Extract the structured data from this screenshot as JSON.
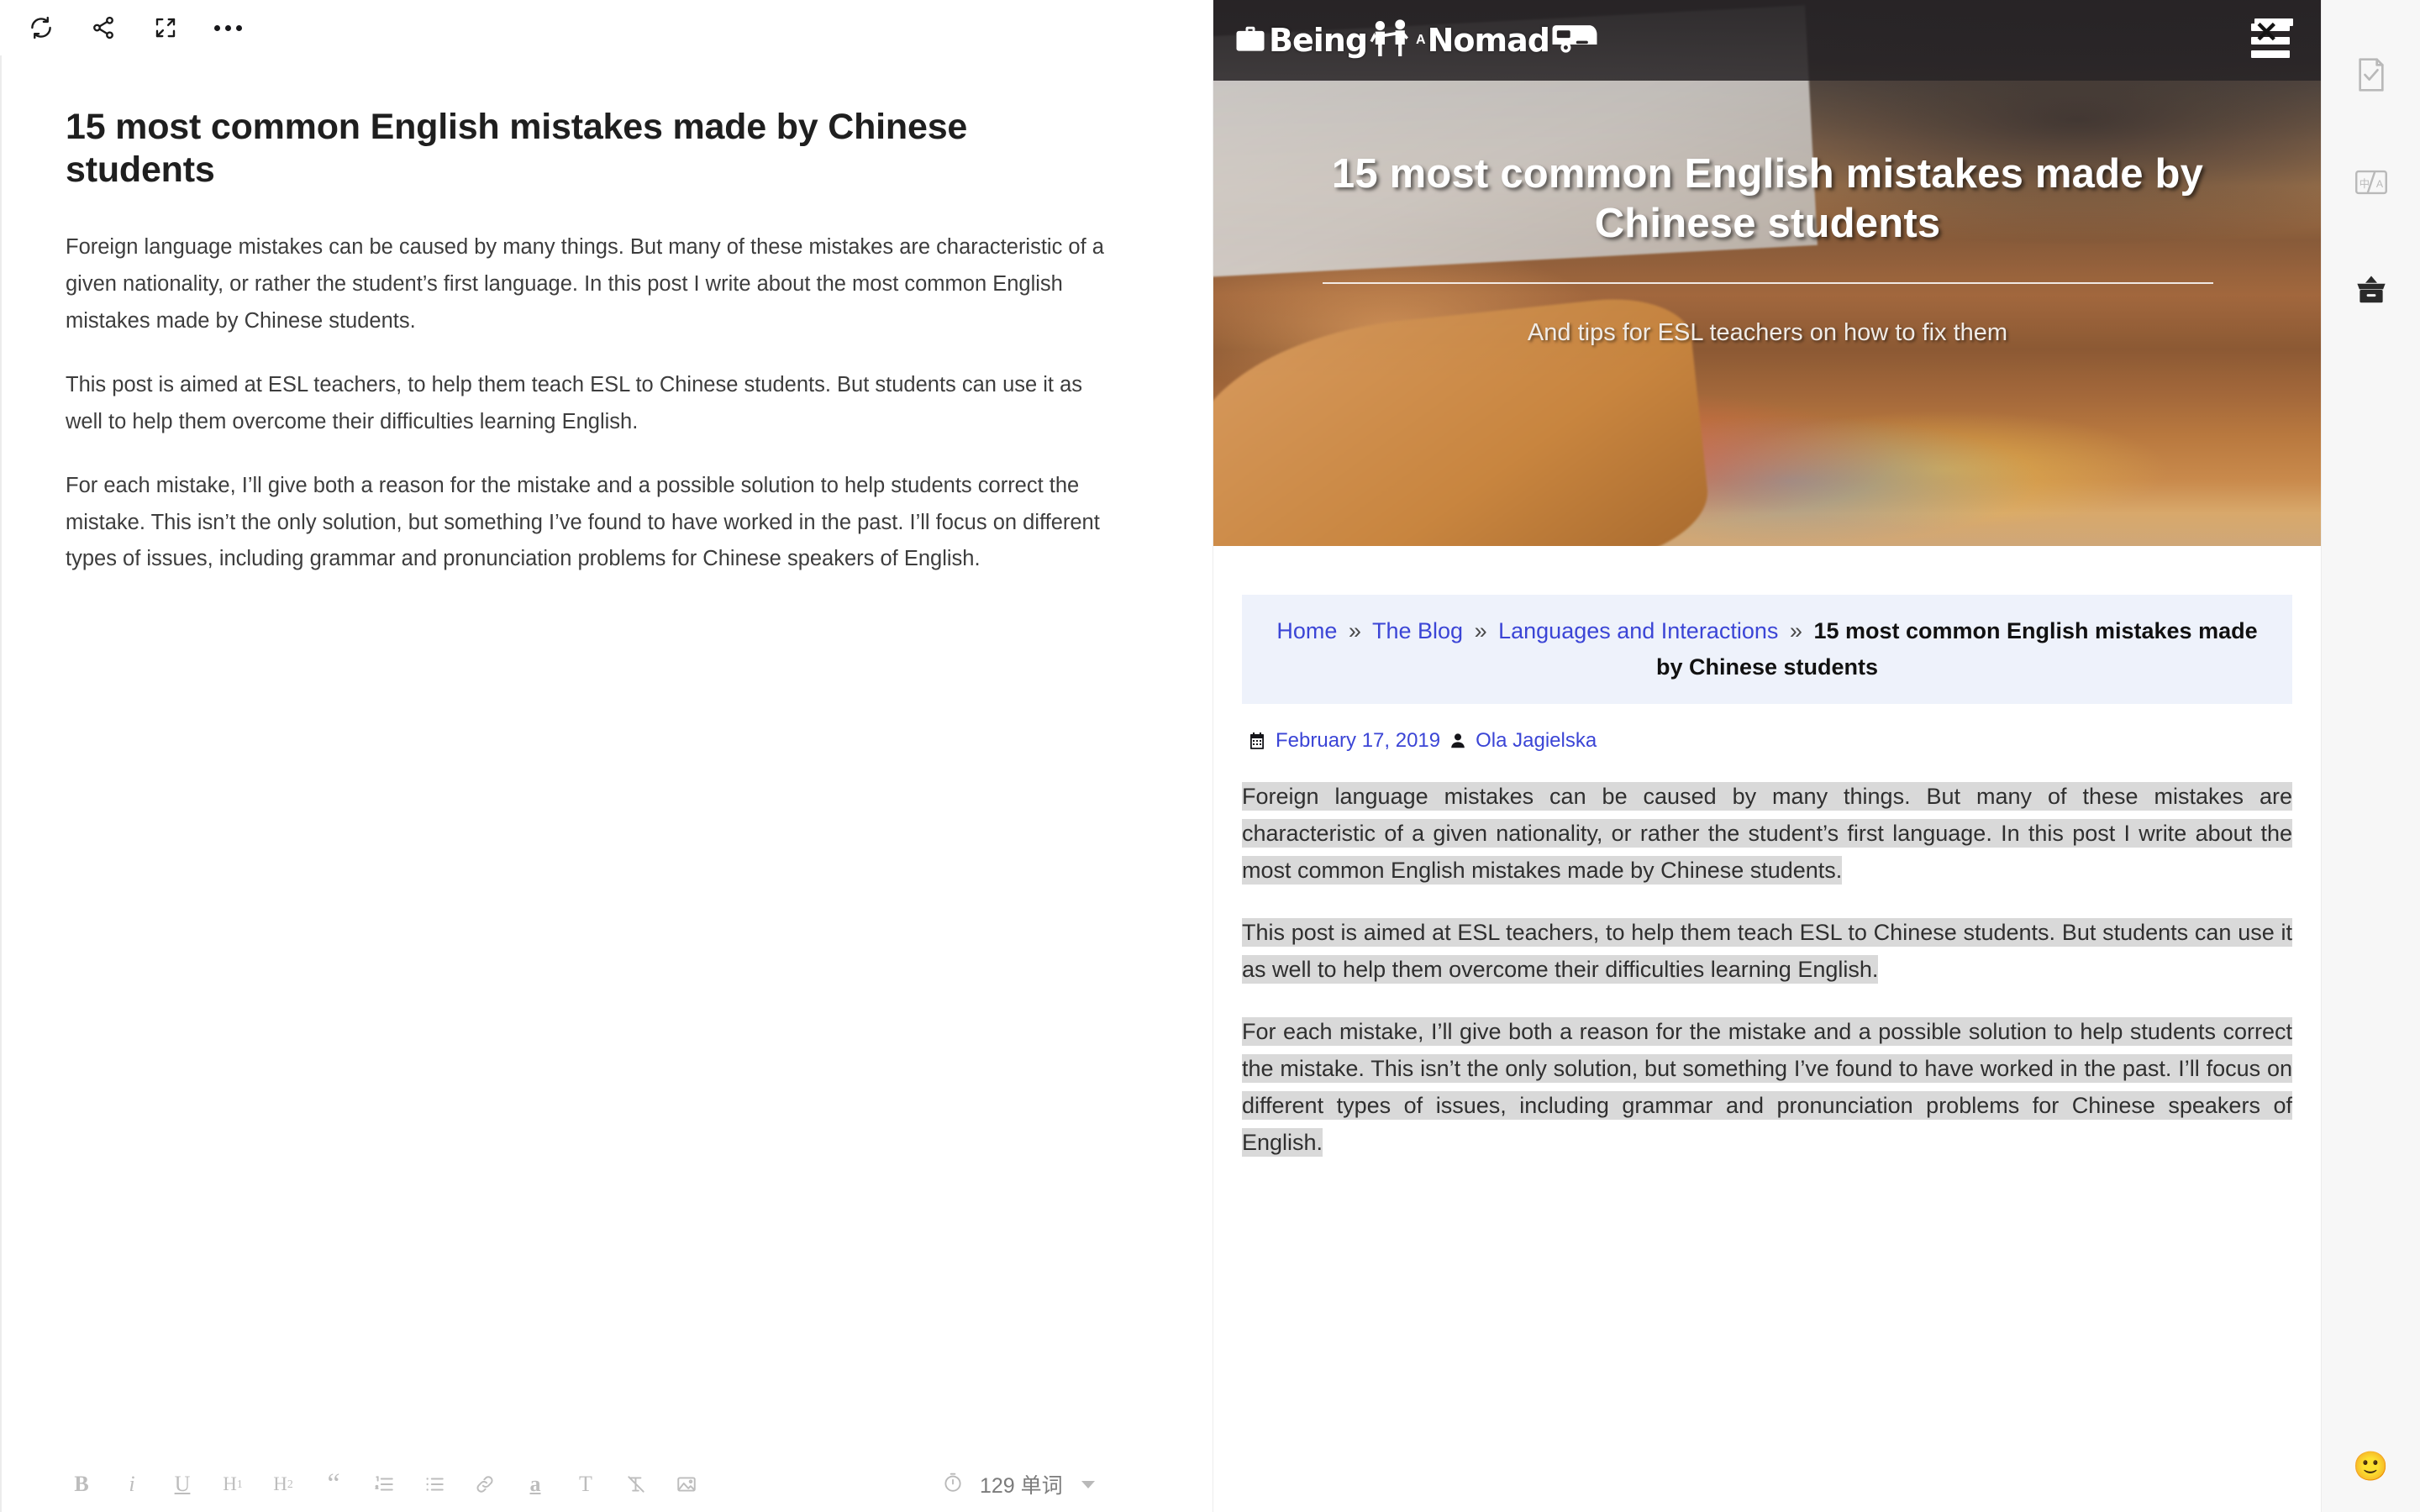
{
  "editor": {
    "toolbar": {
      "sync_label": "sync",
      "share_label": "share",
      "fullscreen_label": "fullscreen",
      "more_label": "more"
    },
    "title": "15 most common English mistakes made by Chinese students",
    "paragraphs": [
      "Foreign language mistakes can be caused by many things. But many of these mistakes are characteristic of a given nationality, or rather the student’s first language. In this post I write about the most common English mistakes made by Chinese students.",
      "This post is aimed at ESL teachers, to help them teach ESL to Chinese students. But students can use it as well to help them overcome their difficulties learning English.",
      "For each mistake, I’ll give both a reason for the mistake and a possible solution to help students correct the mistake. This isn’t the only solution, but something I’ve found to have worked in the past. I’ll focus on different types of issues, including grammar and pronunciation problems for Chinese speakers of English."
    ],
    "format_bar": {
      "bold": "B",
      "italic": "i",
      "underline": "U",
      "heading1": "H",
      "heading1_sub": "1",
      "heading2": "H",
      "heading2_sub": "2",
      "quote": "“",
      "ordered_list": "ordered-list",
      "bullet_list": "bullet-list",
      "link": "link",
      "highlight": "a",
      "text_color": "T",
      "clear_format": "clear-format",
      "image": "image"
    },
    "word_count": "129 单词"
  },
  "web": {
    "site": {
      "logo_word1": "Being",
      "logo_a": "A",
      "logo_word2": "Nomad",
      "menu_label": "menu"
    },
    "hero": {
      "title": "15 most common English mistakes made by Chinese students",
      "subtitle": "And tips for ESL teachers on how to fix them"
    },
    "breadcrumb": {
      "items": [
        {
          "label": "Home",
          "link": true
        },
        {
          "label": "The Blog",
          "link": true
        },
        {
          "label": "Languages and Interactions",
          "link": true
        }
      ],
      "separator": "»",
      "current": "15 most common English mistakes made by Chinese students"
    },
    "meta": {
      "date": "February 17, 2019",
      "author": "Ola Jagielska"
    },
    "paragraphs": [
      "Foreign language mistakes can be caused by many things. But many of these mistakes are characteristic of a given nationality, or rather the student’s first language. In this post I write about the most common English mistakes made by Chinese students.",
      "This post is aimed at ESL teachers, to help them teach ESL to Chinese students. But students can use it as well to help them overcome their difficulties learning English.",
      "For each mistake, I’ll give both a reason for the mistake and a possible solution to help students correct the mistake. This isn’t the only solution, but something I’ve found to have worked in the past. I’ll focus on different types of issues, including grammar and pronunciation problems for Chinese speakers of English."
    ]
  },
  "sidebar": {
    "items": [
      {
        "name": "note-check-icon",
        "label": "note"
      },
      {
        "name": "translate-icon",
        "label": "中/A"
      },
      {
        "name": "collect-box-icon",
        "label": "collect"
      }
    ],
    "emoji": "🙂"
  },
  "colors": {
    "accent_link": "#3b45d6",
    "breadcrumb_bg": "#eef2fb",
    "selection_bg": "#d9d9d9",
    "sidebar_bg": "#f7f7f7",
    "header_bg": "#242123"
  }
}
